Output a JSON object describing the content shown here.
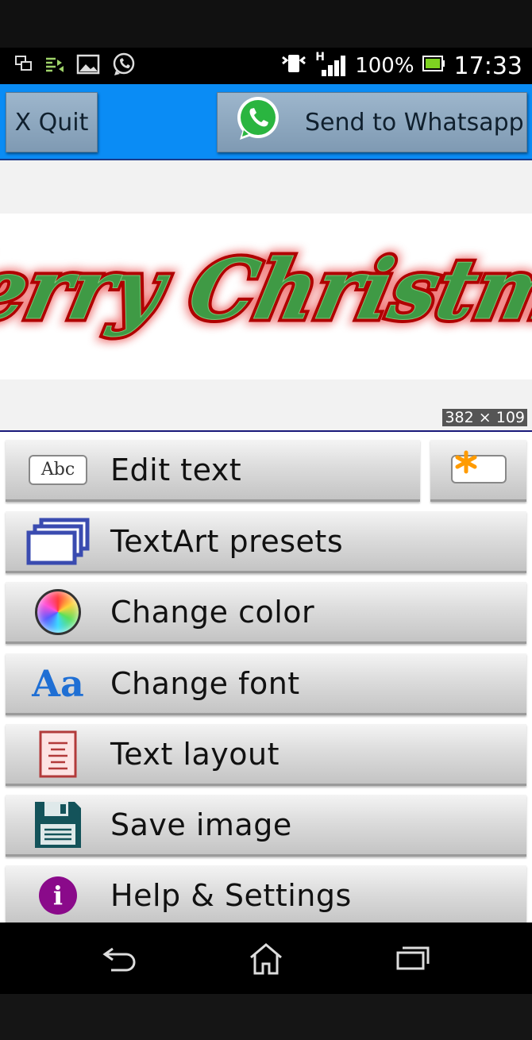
{
  "status_bar": {
    "left_icons": [
      "screens-icon",
      "transfer-icon",
      "image-icon",
      "whatsapp-icon"
    ],
    "network_type": "H",
    "battery_percent": "100%",
    "time": "17:33"
  },
  "action_bar": {
    "quit_label": "X Quit",
    "send_label": "Send to Whatsapp",
    "color": "#0a8cf5"
  },
  "preview": {
    "text_art": "Merry Christmas",
    "fill_color": "#3f9a45",
    "outline_color": "#c00000",
    "dimensions": "382 × 109"
  },
  "menu": {
    "items": [
      {
        "label": "Edit text",
        "icon": "abc-icon"
      },
      {
        "label": "TextArt presets",
        "icon": "presets-icon"
      },
      {
        "label": "Change color",
        "icon": "color-wheel-icon"
      },
      {
        "label": "Change font",
        "icon": "font-icon"
      },
      {
        "label": "Text layout",
        "icon": "text-layout-icon"
      },
      {
        "label": "Save image",
        "icon": "floppy-icon"
      },
      {
        "label": "Help & Settings",
        "icon": "info-icon"
      }
    ],
    "abc_icon_text": "Abc",
    "font_icon_text": "Aa",
    "info_icon_text": "i"
  },
  "nav_bar": {
    "buttons": [
      "back-icon",
      "home-icon",
      "recents-icon"
    ]
  }
}
